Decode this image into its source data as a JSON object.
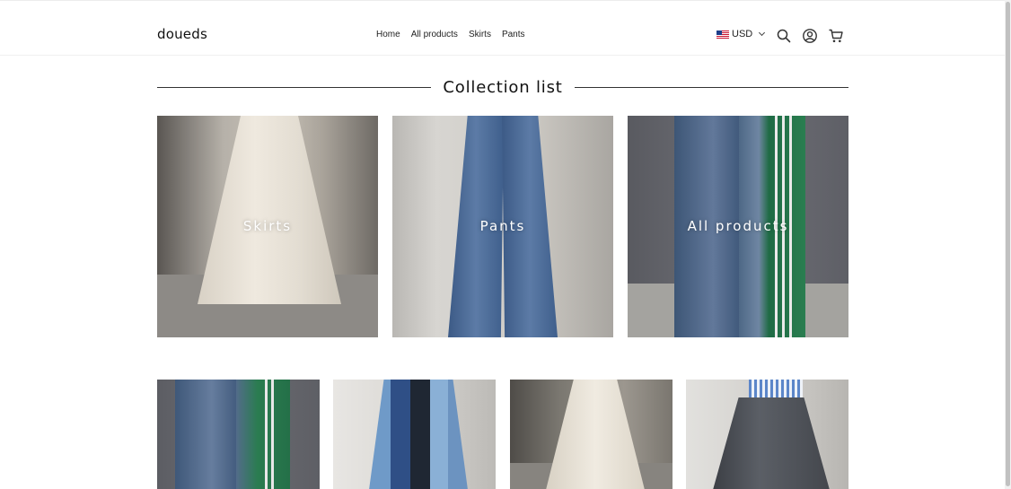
{
  "header": {
    "logo": "doueds",
    "nav": [
      "Home",
      "All products",
      "Skirts",
      "Pants"
    ],
    "currency": {
      "code": "USD",
      "flag": "us-flag-icon"
    },
    "icons": [
      "search-icon",
      "account-icon",
      "cart-icon"
    ]
  },
  "collection_list": {
    "title": "Collection list",
    "items": [
      {
        "label": "Skirts"
      },
      {
        "label": "Pants"
      },
      {
        "label": "All products"
      }
    ]
  },
  "products": [
    {
      "image": "striped-denim-pants"
    },
    {
      "image": "patchwork-wide-pants"
    },
    {
      "image": "cream-knit-skirt"
    },
    {
      "image": "gray-pleated-skirt"
    }
  ],
  "colors": {
    "text": "#222222",
    "rule": "#333333",
    "background": "#ffffff"
  }
}
